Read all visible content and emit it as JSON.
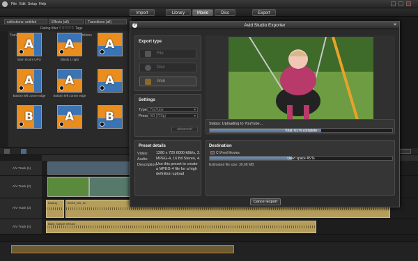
{
  "menu": {
    "file": "File",
    "edit": "Edit",
    "setup": "Setup",
    "help": "Help"
  },
  "modes": {
    "import": "Import",
    "library": "Library",
    "movie": "Movie",
    "disc": "Disc",
    "export": "Export"
  },
  "library": {
    "tabs": [
      "collections: untitled",
      "Effects (all)",
      "Transitions (all)"
    ],
    "rating_filter": "Rating filter",
    "stars": "☆☆☆☆☆",
    "tags": "Tags",
    "section_left": "2D Transitions",
    "section_right": "Standard Transitions",
    "items": [
      {
        "label": "Barn Doors UPU",
        "letter": "A"
      },
      {
        "label": "Blinds 1 right",
        "letter": "A"
      },
      {
        "label": "",
        "letter": "A"
      },
      {
        "label": "Bottom left corner edge",
        "letter": "A"
      },
      {
        "label": "Bottom left corner edge",
        "letter": "A"
      },
      {
        "label": "",
        "letter": "A"
      },
      {
        "label": "",
        "letter": "B"
      },
      {
        "label": "",
        "letter": "A"
      },
      {
        "label": "",
        "letter": "B"
      }
    ]
  },
  "timeline": {
    "tracks": [
      {
        "name": "A/V Track (1)"
      },
      {
        "name": "A/V Track (2)"
      },
      {
        "name": "A/V Track (3)"
      },
      {
        "name": "A/V Track (4)"
      }
    ],
    "audio_labels": [
      "Kissing",
      "BOSS_GD_Sh",
      "Baby, Sample Version"
    ]
  },
  "dialog": {
    "title": "Avid Studio Exporter",
    "help_icon": "?",
    "close_icon": "✕",
    "export_type": {
      "title": "Export type",
      "file": "File",
      "disc": "Disc",
      "web": "Web"
    },
    "settings": {
      "title": "Settings",
      "type_label": "Type:",
      "type_value": "YouTube",
      "preset_label": "Preset:",
      "preset_value": "HD (720p)",
      "advanced": "advanced"
    },
    "preset_details": {
      "title": "Preset details",
      "video_label": "Video:",
      "video_value": "1280 x 720 6000 kBit/s, 2...",
      "audio_label": "Audio:",
      "audio_value": "MPEG-4, 16 Bit Stereo, 4...",
      "description_label": "Description:",
      "description_value": "Use this preset to create a MPEG-4 file for a high definition upload"
    },
    "status": {
      "text": "Status: Uploading to YouTube...",
      "total_label": "Total: 61 % complete",
      "total_pct": 0.61
    },
    "destination": {
      "title": "Destination",
      "item": "C:\\Fred Movies",
      "used_label": "Used space 45 %",
      "used_pct": 0.45,
      "estimated": "Estimated file size: 36.68 MB"
    },
    "cancel": "Cancel Export"
  }
}
